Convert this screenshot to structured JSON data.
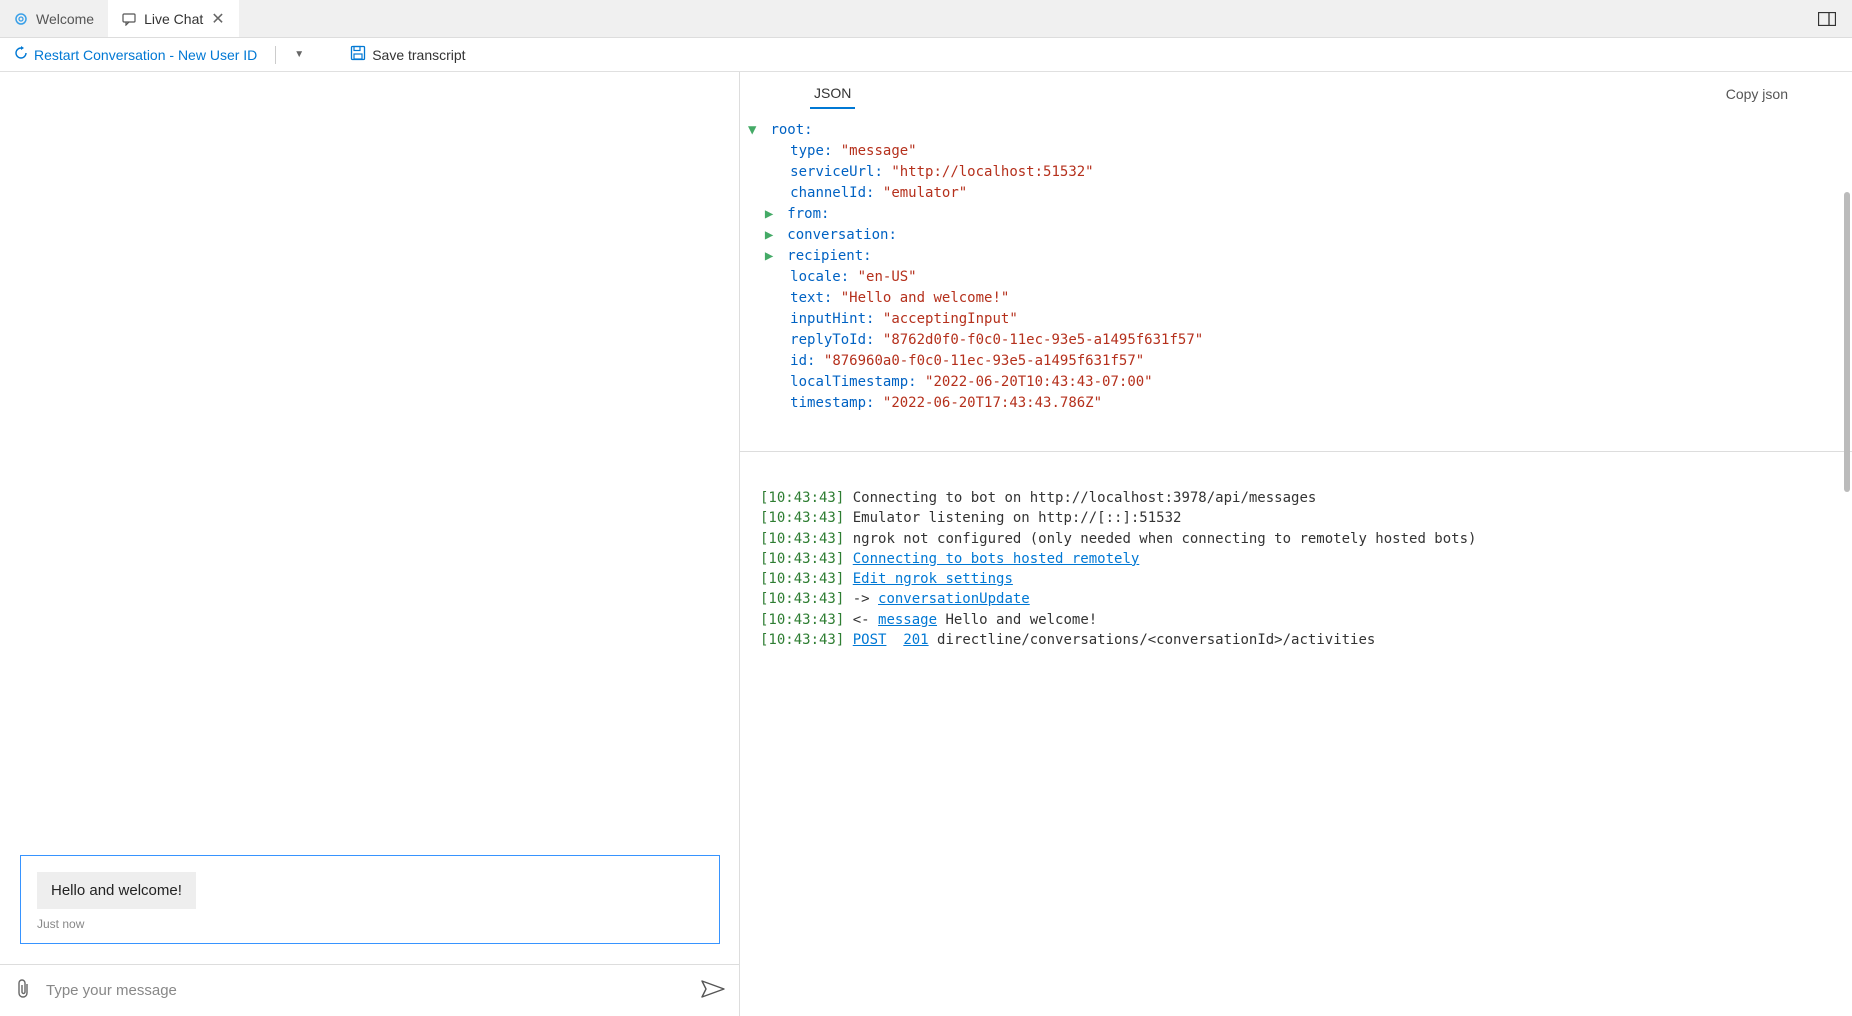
{
  "tabs": [
    {
      "label": "Welcome",
      "active": false
    },
    {
      "label": "Live Chat",
      "active": true
    }
  ],
  "toolbar": {
    "restart_label": "Restart Conversation - New User ID",
    "save_label": "Save transcript"
  },
  "chat": {
    "message": "Hello and welcome!",
    "timestamp_label": "Just now",
    "input_placeholder": "Type your message"
  },
  "json_panel": {
    "tab_label": "JSON",
    "copy_label": "Copy json",
    "root_label": "root:",
    "fields": {
      "type_k": "type:",
      "type_v": "\"message\"",
      "serviceUrl_k": "serviceUrl:",
      "serviceUrl_v": "\"http://localhost:51532\"",
      "channelId_k": "channelId:",
      "channelId_v": "\"emulator\"",
      "from_k": "from:",
      "conversation_k": "conversation:",
      "recipient_k": "recipient:",
      "locale_k": "locale:",
      "locale_v": "\"en-US\"",
      "text_k": "text:",
      "text_v": "\"Hello and welcome!\"",
      "inputHint_k": "inputHint:",
      "inputHint_v": "\"acceptingInput\"",
      "replyToId_k": "replyToId:",
      "replyToId_v": "\"8762d0f0-f0c0-11ec-93e5-a1495f631f57\"",
      "id_k": "id:",
      "id_v": "\"876960a0-f0c0-11ec-93e5-a1495f631f57\"",
      "localTimestamp_k": "localTimestamp:",
      "localTimestamp_v": "\"2022-06-20T10:43:43-07:00\"",
      "timestamp_k": "timestamp:",
      "timestamp_v": "\"2022-06-20T17:43:43.786Z\""
    }
  },
  "log": {
    "lines": [
      {
        "ts": "[10:43:43]",
        "parts": [
          {
            "t": "text",
            "v": " Connecting to bot on http://localhost:3978/api/messages"
          }
        ]
      },
      {
        "ts": "[10:43:43]",
        "parts": [
          {
            "t": "text",
            "v": " Emulator listening on http://[::]:51532"
          }
        ]
      },
      {
        "ts": "[10:43:43]",
        "parts": [
          {
            "t": "text",
            "v": " ngrok not configured (only needed when connecting to remotely hosted bots)"
          }
        ]
      },
      {
        "ts": "[10:43:43]",
        "parts": [
          {
            "t": "text",
            "v": " "
          },
          {
            "t": "link",
            "v": "Connecting to bots hosted remotely"
          }
        ]
      },
      {
        "ts": "[10:43:43]",
        "parts": [
          {
            "t": "text",
            "v": " "
          },
          {
            "t": "link",
            "v": "Edit ngrok settings"
          }
        ]
      },
      {
        "ts": "[10:43:43]",
        "parts": [
          {
            "t": "text",
            "v": " -> "
          },
          {
            "t": "link",
            "v": "conversationUpdate"
          }
        ]
      },
      {
        "ts": "[10:43:43]",
        "parts": [
          {
            "t": "text",
            "v": " <- "
          },
          {
            "t": "link",
            "v": "message"
          },
          {
            "t": "text",
            "v": " Hello and welcome!"
          }
        ]
      },
      {
        "ts": "[10:43:43]",
        "parts": [
          {
            "t": "text",
            "v": " "
          },
          {
            "t": "link",
            "v": "POST"
          },
          {
            "t": "text",
            "v": "  "
          },
          {
            "t": "link",
            "v": "201"
          },
          {
            "t": "text",
            "v": " directline/conversations/<conversationId>/activities"
          }
        ]
      }
    ]
  }
}
